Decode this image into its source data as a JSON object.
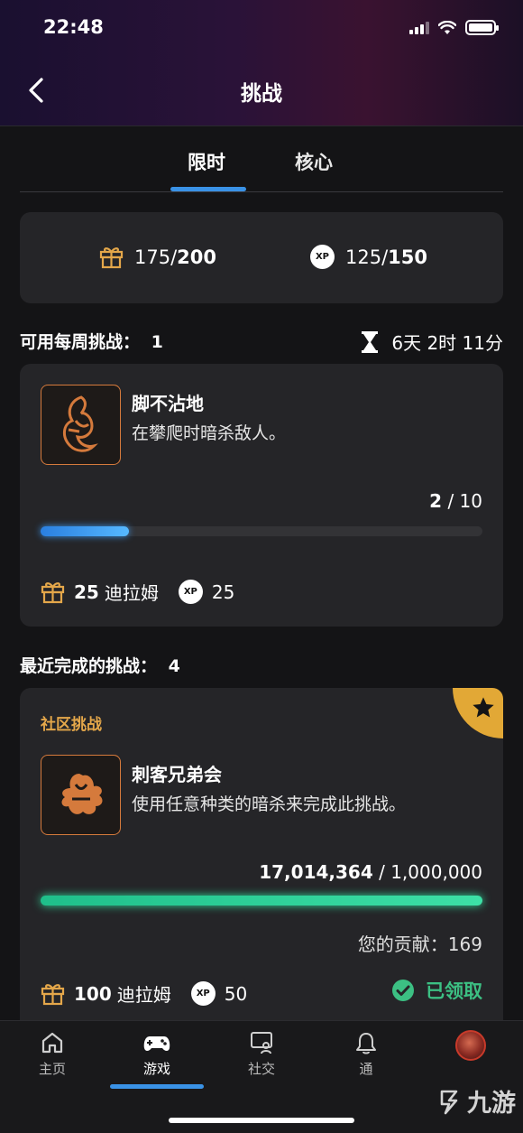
{
  "status_bar": {
    "time": "22:48"
  },
  "header": {
    "title": "挑战"
  },
  "tabs": [
    {
      "label": "限时"
    },
    {
      "label": "核心"
    }
  ],
  "summary": {
    "gift": {
      "current": "175/",
      "total": "200"
    },
    "xp": {
      "current": "125/",
      "total": "150"
    },
    "xp_badge": "XP"
  },
  "weekly": {
    "label": "可用每周挑战：",
    "count": "1",
    "timer": "6天 2时 11分"
  },
  "challenge_1": {
    "name": "脚不沾地",
    "description": "在攀爬时暗杀敌人。",
    "progress_current": "2",
    "progress_total": " / 10",
    "progress_fraction": 0.2,
    "reward_amount": "25",
    "reward_unit": "迪拉姆",
    "xp_badge": "XP",
    "xp_reward": "25",
    "icon": "assassin-climb-emblem-icon"
  },
  "recent": {
    "label": "最近完成的挑战：",
    "count": "4"
  },
  "community_challenge": {
    "tag": "社区挑战",
    "name": "刺客兄弟会",
    "description": "使用任意种类的暗杀来完成此挑战。",
    "progress_current": "17,014,364",
    "progress_total": " / 1,000,000",
    "progress_fraction": 1.0,
    "contribution": "您的贡献：169",
    "reward_amount": "100",
    "reward_unit": "迪拉姆",
    "xp_badge": "XP",
    "xp_reward": "50",
    "claimed_label": "已领取",
    "icon": "assassin-brotherhood-emblem-icon"
  },
  "bottom_nav": [
    {
      "label": "主页",
      "icon": "home-icon"
    },
    {
      "label": "游戏",
      "icon": "gamepad-icon"
    },
    {
      "label": "社交",
      "icon": "social-icon"
    },
    {
      "label": "通",
      "icon": "bell-icon"
    },
    {
      "label": "",
      "icon": "avatar"
    }
  ],
  "watermark": {
    "text": "九游"
  },
  "colors": {
    "accent_blue": "#3a92e6",
    "gold": "#e4a74a",
    "success_green": "#3cc083",
    "card_bg": "#252528"
  }
}
